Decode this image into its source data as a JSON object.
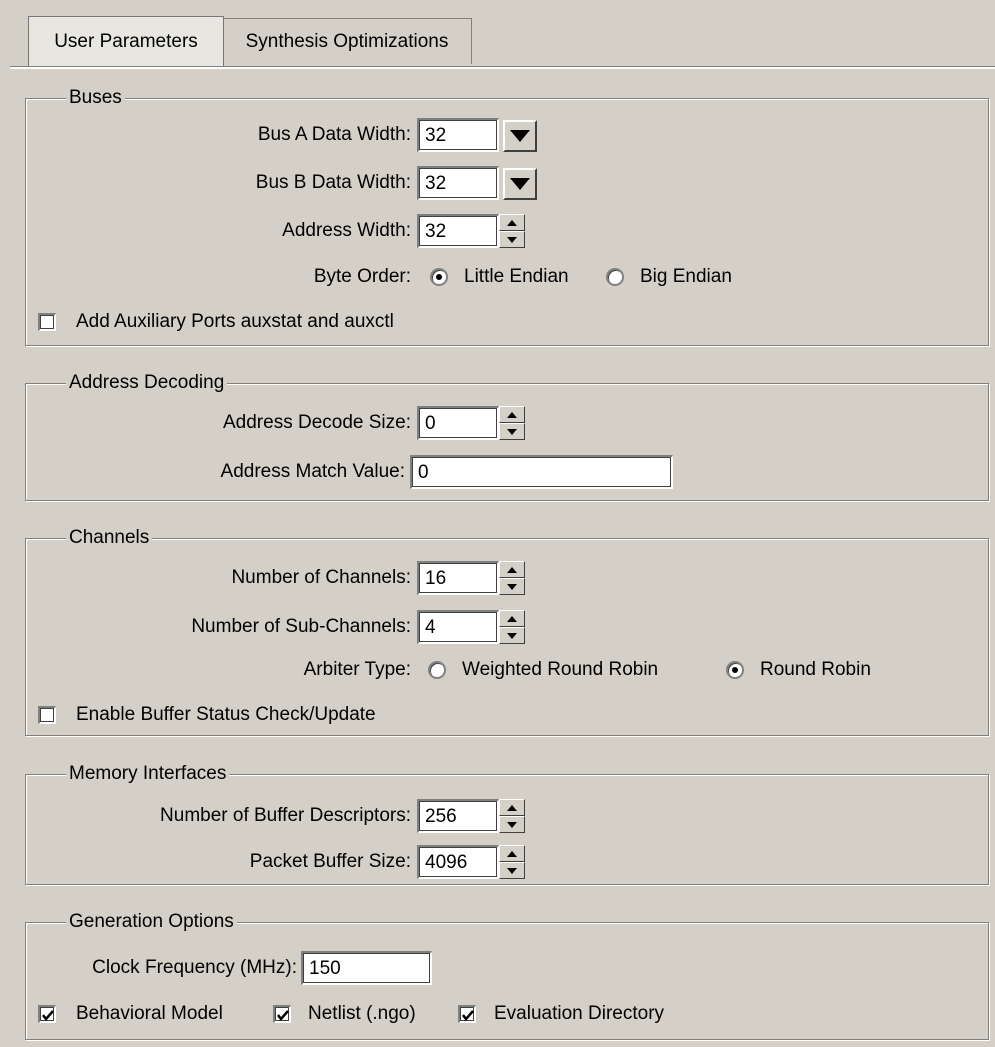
{
  "tabs": [
    {
      "label": "User Parameters",
      "active": true
    },
    {
      "label": "Synthesis Optimizations",
      "active": false
    }
  ],
  "buses": {
    "legend": "Buses",
    "bus_a": {
      "label": "Bus A Data Width:",
      "value": "32"
    },
    "bus_b": {
      "label": "Bus B Data Width:",
      "value": "32"
    },
    "address_width": {
      "label": "Address Width:",
      "value": "32"
    },
    "byte_order": {
      "label": "Byte Order:",
      "options": [
        "Little Endian",
        "Big Endian"
      ],
      "selected": "Little Endian"
    },
    "aux_ports": {
      "label": "Add Auxiliary Ports auxstat and auxctl",
      "checked": false
    }
  },
  "address_decoding": {
    "legend": "Address Decoding",
    "decode_size": {
      "label": "Address Decode Size:",
      "value": "0"
    },
    "match_value": {
      "label": "Address Match Value:",
      "value": "0"
    }
  },
  "channels": {
    "legend": "Channels",
    "num_channels": {
      "label": "Number of Channels:",
      "value": "16"
    },
    "num_sub_channels": {
      "label": "Number of Sub-Channels:",
      "value": "4"
    },
    "arbiter_type": {
      "label": "Arbiter Type:",
      "options": [
        "Weighted Round Robin",
        "Round Robin"
      ],
      "selected": "Round Robin"
    },
    "buffer_status": {
      "label": "Enable Buffer Status Check/Update",
      "checked": false
    }
  },
  "memory_interfaces": {
    "legend": "Memory Interfaces",
    "buffer_descriptors": {
      "label": "Number of Buffer Descriptors:",
      "value": "256"
    },
    "packet_buffer_size": {
      "label": "Packet Buffer Size:",
      "value": "4096"
    }
  },
  "generation_options": {
    "legend": "Generation Options",
    "clock_frequency": {
      "label": "Clock Frequency (MHz):",
      "value": "150"
    },
    "behavioral_model": {
      "label": "Behavioral Model",
      "checked": true
    },
    "netlist": {
      "label": "Netlist (.ngo)",
      "checked": true
    },
    "evaluation_directory": {
      "label": "Evaluation Directory",
      "checked": true
    }
  },
  "icons": {
    "dropdown": "chevron-down-icon",
    "spinner_up": "spin-up-icon",
    "spinner_down": "spin-down-icon",
    "check": "check-icon"
  }
}
